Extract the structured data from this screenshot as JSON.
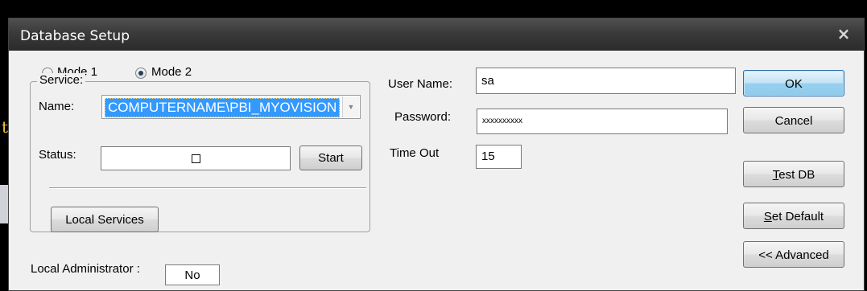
{
  "window": {
    "title": "Database Setup",
    "close_glyph": "×"
  },
  "background": {
    "partial_char": "t"
  },
  "mode": {
    "options": [
      {
        "label": "Mode 1",
        "checked": false
      },
      {
        "label": "Mode 2",
        "checked": true
      }
    ]
  },
  "service": {
    "group_label": "Service:",
    "name_label": "Name:",
    "name_value": "COMPUTERNAME\\PBI_MYOVISION",
    "status_label": "Status:",
    "start_label": "Start",
    "local_services_label": "Local Services"
  },
  "local_admin": {
    "label": "Local Administrator :",
    "value": "No"
  },
  "login": {
    "user_label": "User Name:",
    "user_value": "sa",
    "password_label": "Password:",
    "password_value": "xxxxxxxxxx",
    "timeout_label": "Time Out",
    "timeout_value": "15"
  },
  "buttons": {
    "ok": "OK",
    "cancel": "Cancel",
    "test_db_mnemonic": "T",
    "test_db_rest": "est DB",
    "set_default_mnemonic": "S",
    "set_default_rest": "et Default",
    "advanced": "<< Advanced"
  },
  "colors": {
    "selection": "#3399ff",
    "titlebar": "#3a3a3a",
    "dialog": "#f0f0f0"
  }
}
